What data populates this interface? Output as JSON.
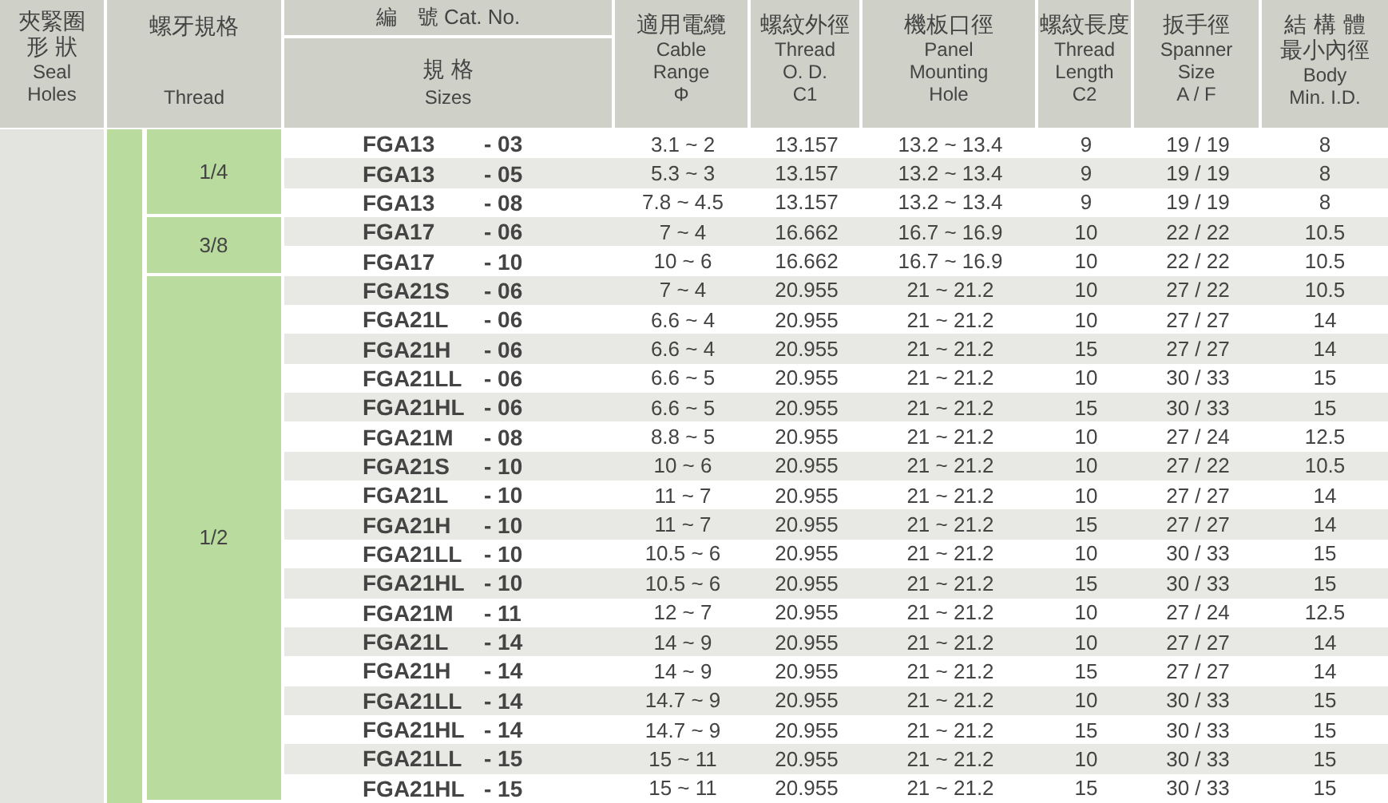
{
  "header": {
    "seal": [
      "夾緊圈",
      "形 狀",
      "Seal",
      "Holes"
    ],
    "thread": [
      "螺牙規格",
      "Thread"
    ],
    "catalog": "編　號  Cat. No.",
    "sizes": [
      "規 格",
      "Sizes"
    ],
    "columns": [
      [
        "適用電纜",
        "Cable",
        "Range",
        "Φ"
      ],
      [
        "螺紋外徑",
        "Thread",
        "O. D.",
        "C1"
      ],
      [
        "機板口徑",
        "Panel",
        "Mounting",
        "Hole"
      ],
      [
        "螺紋長度",
        "Thread",
        "Length",
        "C2"
      ],
      [
        "扳手徑",
        "Spanner",
        "Size",
        "A / F"
      ],
      [
        "結 構 體",
        "最小內徑",
        "Body",
        "Min. I.D."
      ]
    ]
  },
  "groups": [
    {
      "thread": "1/4",
      "rows": [
        [
          "FGA13",
          "- 03",
          "3.1 ~ 2",
          "13.157",
          "13.2 ~ 13.4",
          "9",
          "19 / 19",
          "8"
        ],
        [
          "FGA13",
          "- 05",
          "5.3 ~ 3",
          "13.157",
          "13.2 ~ 13.4",
          "9",
          "19 / 19",
          "8"
        ],
        [
          "FGA13",
          "- 08",
          "7.8 ~ 4.5",
          "13.157",
          "13.2 ~ 13.4",
          "9",
          "19 / 19",
          "8"
        ]
      ]
    },
    {
      "thread": "3/8",
      "rows": [
        [
          "FGA17",
          "- 06",
          "7 ~ 4",
          "16.662",
          "16.7 ~ 16.9",
          "10",
          "22 / 22",
          "10.5"
        ],
        [
          "FGA17",
          "- 10",
          "10 ~ 6",
          "16.662",
          "16.7 ~ 16.9",
          "10",
          "22 / 22",
          "10.5"
        ]
      ]
    },
    {
      "thread": "1/2",
      "rows": [
        [
          "FGA21S",
          "- 06",
          "7 ~ 4",
          "20.955",
          "21 ~ 21.2",
          "10",
          "27 / 22",
          "10.5"
        ],
        [
          "FGA21L",
          "- 06",
          "6.6 ~ 4",
          "20.955",
          "21 ~ 21.2",
          "10",
          "27 / 27",
          "14"
        ],
        [
          "FGA21H",
          "- 06",
          "6.6 ~ 4",
          "20.955",
          "21 ~ 21.2",
          "15",
          "27 / 27",
          "14"
        ],
        [
          "FGA21LL",
          "- 06",
          "6.6 ~ 5",
          "20.955",
          "21 ~ 21.2",
          "10",
          "30 / 33",
          "15"
        ],
        [
          "FGA21HL",
          "- 06",
          "6.6 ~ 5",
          "20.955",
          "21 ~ 21.2",
          "15",
          "30 / 33",
          "15"
        ],
        [
          "FGA21M",
          "- 08",
          "8.8 ~ 5",
          "20.955",
          "21 ~ 21.2",
          "10",
          "27 / 24",
          "12.5"
        ],
        [
          "FGA21S",
          "- 10",
          "10 ~ 6",
          "20.955",
          "21 ~ 21.2",
          "10",
          "27 / 22",
          "10.5"
        ],
        [
          "FGA21L",
          "- 10",
          "11 ~ 7",
          "20.955",
          "21 ~ 21.2",
          "10",
          "27 / 27",
          "14"
        ],
        [
          "FGA21H",
          "- 10",
          "11 ~ 7",
          "20.955",
          "21 ~ 21.2",
          "15",
          "27 / 27",
          "14"
        ],
        [
          "FGA21LL",
          "- 10",
          "10.5 ~ 6",
          "20.955",
          "21 ~ 21.2",
          "10",
          "30 / 33",
          "15"
        ],
        [
          "FGA21HL",
          "- 10",
          "10.5 ~ 6",
          "20.955",
          "21 ~ 21.2",
          "15",
          "30 / 33",
          "15"
        ],
        [
          "FGA21M",
          "- 11",
          "12 ~ 7",
          "20.955",
          "21 ~ 21.2",
          "10",
          "27 / 24",
          "12.5"
        ],
        [
          "FGA21L",
          "- 14",
          "14 ~ 9",
          "20.955",
          "21 ~ 21.2",
          "10",
          "27 / 27",
          "14"
        ],
        [
          "FGA21H",
          "- 14",
          "14 ~ 9",
          "20.955",
          "21 ~ 21.2",
          "15",
          "27 / 27",
          "14"
        ],
        [
          "FGA21LL",
          "- 14",
          "14.7 ~ 9",
          "20.955",
          "21 ~ 21.2",
          "10",
          "30 / 33",
          "15"
        ],
        [
          "FGA21HL",
          "- 14",
          "14.7 ~ 9",
          "20.955",
          "21 ~ 21.2",
          "15",
          "30 / 33",
          "15"
        ],
        [
          "FGA21LL",
          "- 15",
          "15 ~ 11",
          "20.955",
          "21 ~ 21.2",
          "10",
          "30 / 33",
          "15"
        ],
        [
          "FGA21HL",
          "- 15",
          "15 ~ 11",
          "20.955",
          "21 ~ 21.2",
          "15",
          "30 / 33",
          "15"
        ]
      ]
    }
  ]
}
